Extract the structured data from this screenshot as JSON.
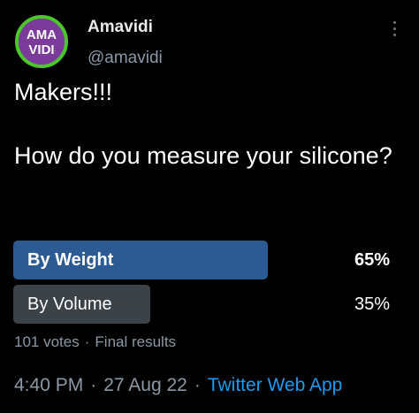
{
  "author": {
    "display_name": "Amavidi",
    "handle": "@amavidi",
    "avatar_logo_text": "AMA VIDI"
  },
  "tweet": {
    "text": "Makers!!!\n\nHow do you measure your silicone?"
  },
  "poll": {
    "options": [
      {
        "label": "By Weight",
        "percent": "65%",
        "share": 65,
        "winner": true
      },
      {
        "label": "By Volume",
        "percent": "35%",
        "share": 35,
        "winner": false
      }
    ],
    "votes": "101 votes",
    "status": "Final results",
    "separator": "·"
  },
  "timestamp": {
    "time": "4:40 PM",
    "date": "27 Aug 22",
    "separator": "·",
    "source": "Twitter Web App"
  },
  "icons": {
    "more": "more-icon"
  },
  "colors": {
    "background": "#000000",
    "winner_bar": "#2b5b92",
    "other_bar": "#3b4248",
    "link": "#1d9bf0",
    "secondary_text": "#8b98a5",
    "avatar_border": "#4cc72b",
    "avatar_fill": "#7a3b9a"
  }
}
